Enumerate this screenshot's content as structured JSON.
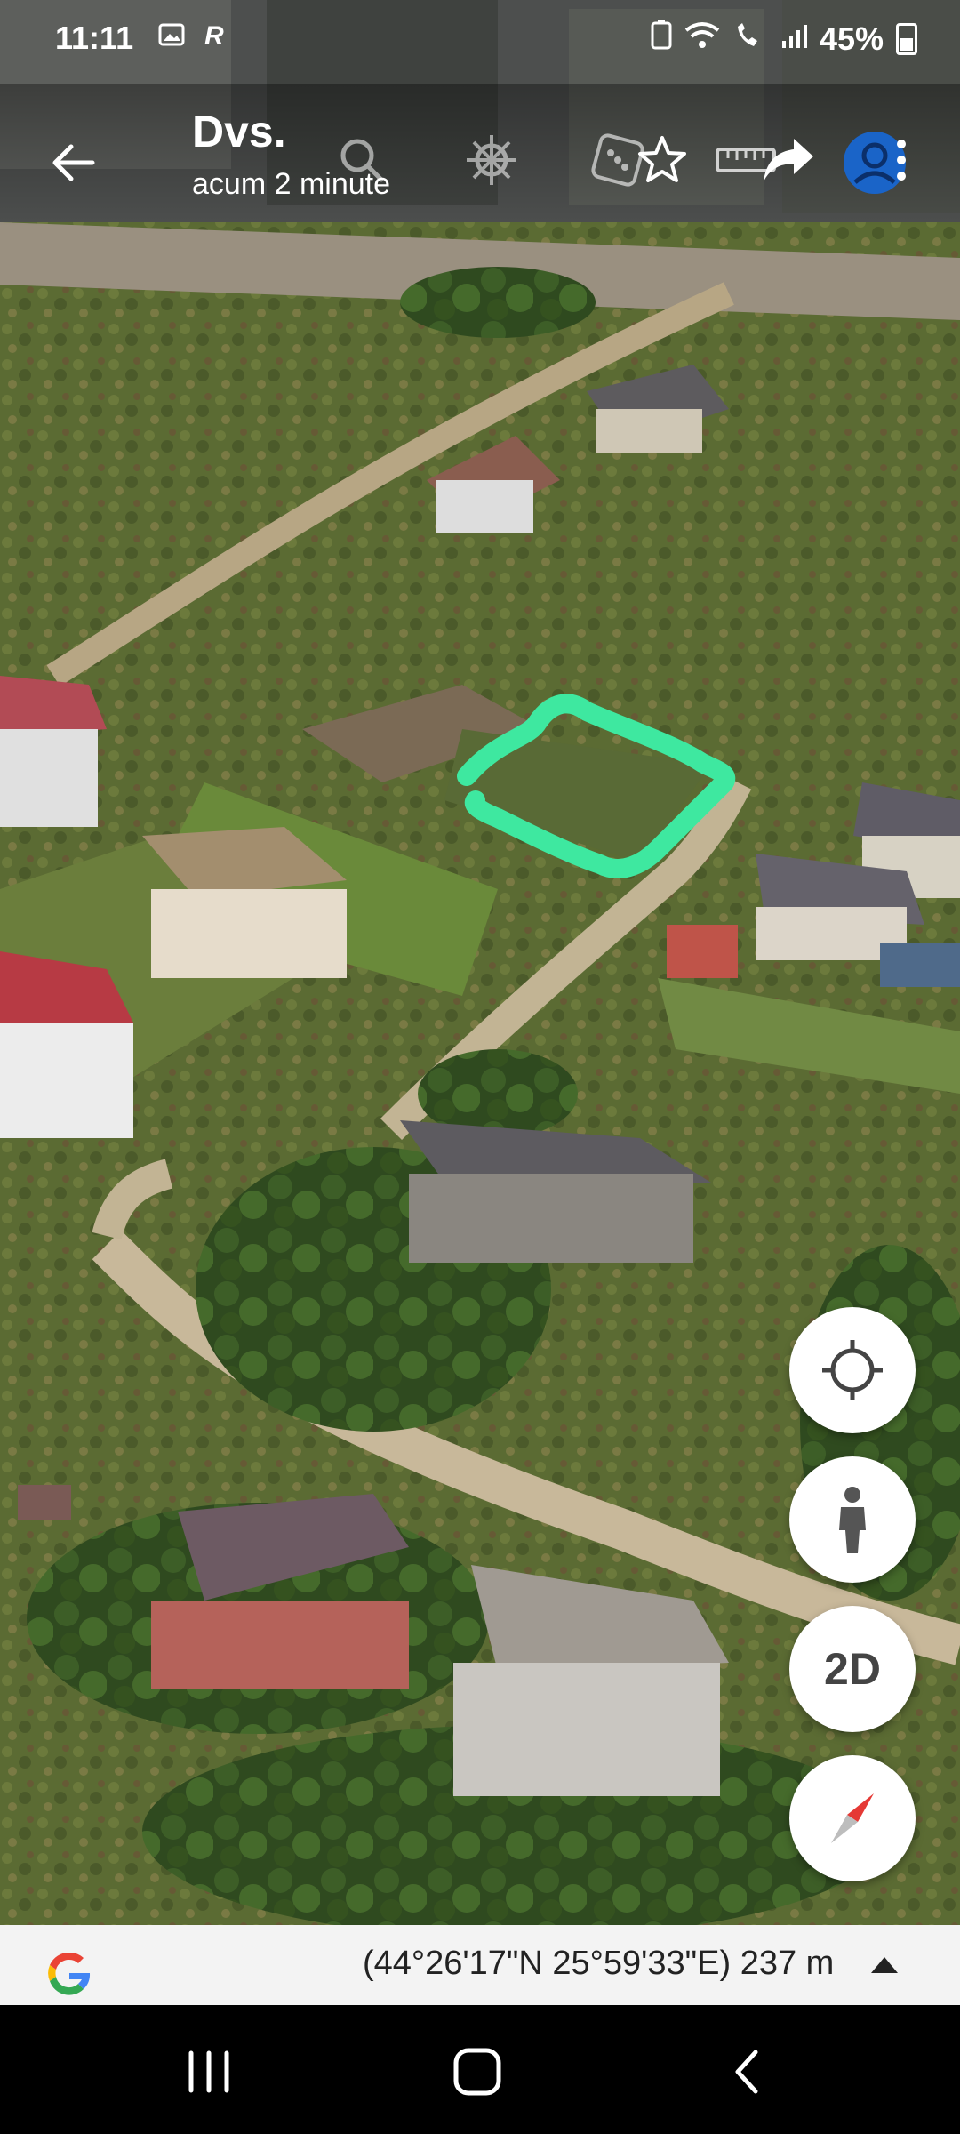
{
  "status": {
    "time": "11:11",
    "battery": "45%",
    "left_icons": [
      "gallery-icon",
      "r-badge-icon"
    ],
    "right_icons": [
      "battery-saver-icon",
      "wifi-icon",
      "wifi-calling-icon",
      "signal-icon"
    ]
  },
  "header": {
    "title": "Dvs.",
    "subtitle": "acum 2 minute",
    "actions": [
      "search-icon",
      "ship-wheel-icon",
      "dice-icon",
      "star-icon",
      "ruler-icon",
      "share-icon",
      "account-icon",
      "more-icon"
    ]
  },
  "map": {
    "highlight_color": "#3ee8a0",
    "buttons": {
      "location": "crosshair-icon",
      "street_view": "pegman-icon",
      "view_mode": "2D",
      "compass": "compass-icon"
    }
  },
  "footer": {
    "coordinates": "(44°26'17\"N 25°59'33\"E) 237 m"
  },
  "colors": {
    "roof_red": "#b73a44",
    "grass": "#5e6e36",
    "road": "#c8b89a"
  }
}
